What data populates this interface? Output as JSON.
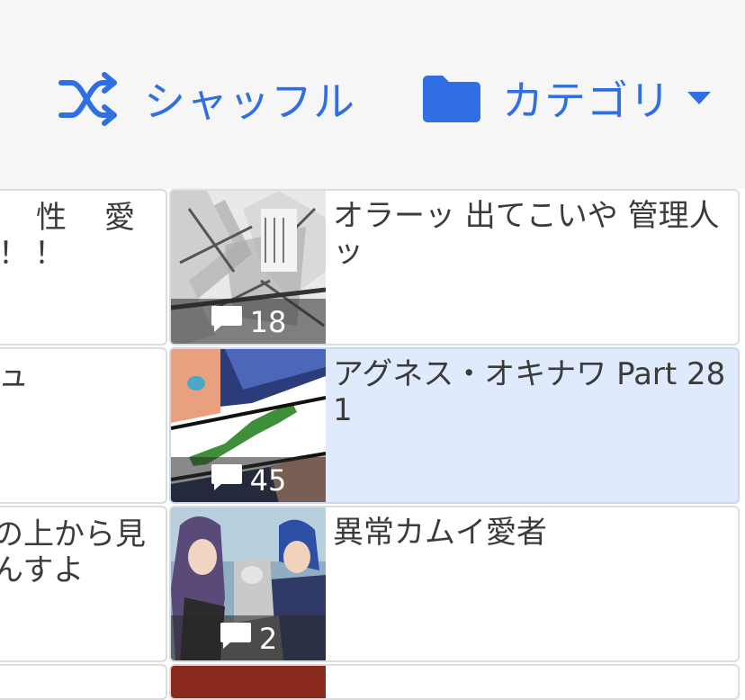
{
  "toolbar": {
    "shuffle_label": "シャッフル",
    "category_label": "カテゴリ",
    "accent_color": "#2f6fe3",
    "icons": [
      "shuffle-icon",
      "folder-icon",
      "caret-down-icon"
    ]
  },
  "threads": [
    {
      "left_title_fragment_line1": "性　愛",
      "left_title_fragment_line2": "！！",
      "title": "オラーッ 出てこいや 管理人ッ",
      "comments": "18"
    },
    {
      "left_title_fragment_line1": "ュ",
      "left_title_fragment_line2": "",
      "title": "アグネス・オキナワ Part 281",
      "comments": "45",
      "selected": true
    },
    {
      "left_title_fragment_line1": "の上から見",
      "left_title_fragment_line2": "んすよ",
      "title": "異常カムイ愛者",
      "comments": "2"
    }
  ]
}
